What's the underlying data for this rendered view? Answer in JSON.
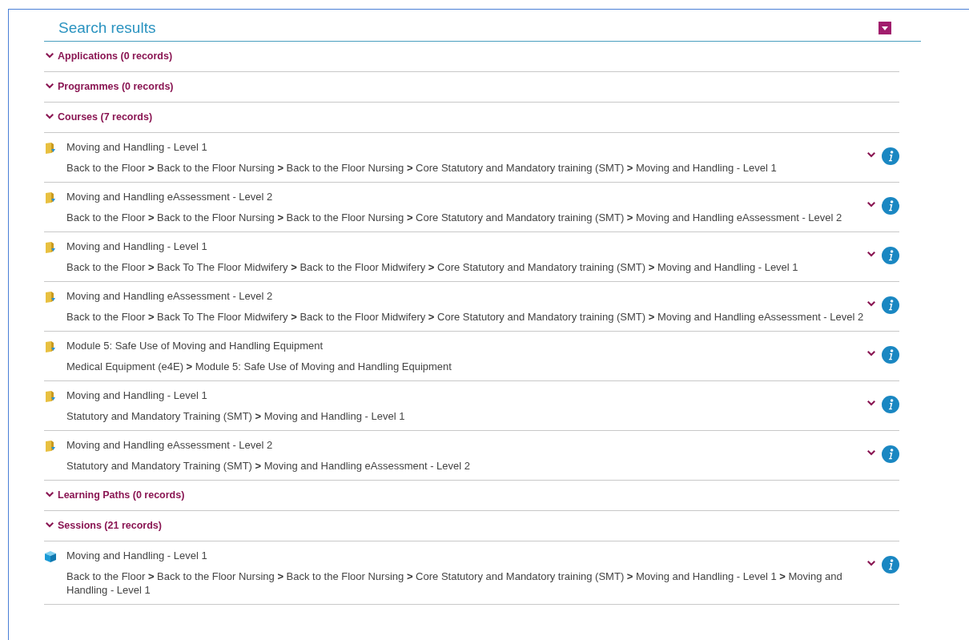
{
  "title": "Search results",
  "sections": [
    {
      "label": "Applications (0 records)",
      "expanded": true
    },
    {
      "label": "Programmes (0 records)",
      "expanded": true
    },
    {
      "label": "Courses (7 records)",
      "expanded": true,
      "items": [
        {
          "kind": "course",
          "title": "Moving and Handling - Level 1",
          "path": "Back to the Floor **>** Back to the Floor Nursing **>** Back to the Floor Nursing **>** Core Statutory and Mandatory training (SMT) **>** Moving and Handling - Level 1"
        },
        {
          "kind": "course",
          "title": "Moving and Handling eAssessment - Level 2",
          "path": "Back to the Floor **>** Back to the Floor Nursing **>** Back to the Floor Nursing **>** Core Statutory and Mandatory training (SMT) **>** Moving and Handling eAssessment - Level 2"
        },
        {
          "kind": "course",
          "title": "Moving and Handling - Level 1",
          "path": "Back to the Floor **>** Back To The Floor Midwifery **>** Back to the Floor Midwifery **>** Core Statutory and Mandatory training (SMT) **>** Moving and Handling - Level 1"
        },
        {
          "kind": "course",
          "title": "Moving and Handling eAssessment - Level 2",
          "path": "Back to the Floor **>** Back To The Floor Midwifery **>** Back to the Floor Midwifery **>** Core Statutory and Mandatory training (SMT) **>** Moving and Handling eAssessment - Level 2"
        },
        {
          "kind": "course",
          "title": "Module 5: Safe Use of Moving and Handling Equipment",
          "path": "Medical Equipment (e4E) **>** Module 5: Safe Use of Moving and Handling Equipment"
        },
        {
          "kind": "course",
          "title": "Moving and Handling - Level 1",
          "path": "Statutory and Mandatory Training (SMT) **>** Moving and Handling - Level 1"
        },
        {
          "kind": "course",
          "title": "Moving and Handling eAssessment - Level 2",
          "path": "Statutory and Mandatory Training (SMT) **>** Moving and Handling eAssessment - Level 2"
        }
      ]
    },
    {
      "label": "Learning Paths (0 records)",
      "expanded": true
    },
    {
      "label": "Sessions (21 records)",
      "expanded": true,
      "items": [
        {
          "kind": "session",
          "title": "Moving and Handling - Level 1",
          "path": "Back to the Floor **>** Back to the Floor Nursing **>** Back to the Floor Nursing **>** Core Statutory and Mandatory training (SMT) **>** Moving and Handling - Level 1 **>** Moving and Handling - Level 1"
        }
      ]
    }
  ]
}
